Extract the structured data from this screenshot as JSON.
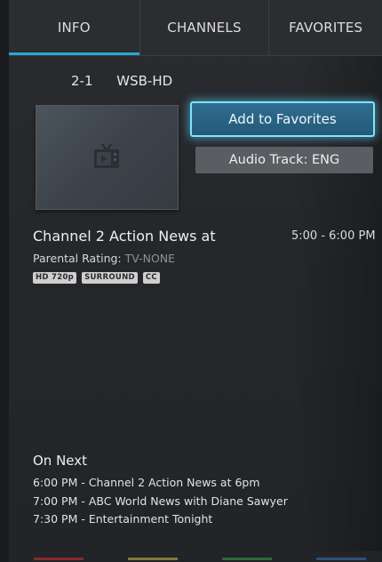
{
  "tabs": [
    {
      "label": "INFO",
      "active": true
    },
    {
      "label": "CHANNELS",
      "active": false
    },
    {
      "label": "FAVORITES",
      "active": false
    }
  ],
  "channel": {
    "number": "2-1",
    "name": "WSB-HD"
  },
  "thumbnail": {
    "icon": "tv-icon"
  },
  "actions": {
    "add_favorites": "Add to Favorites",
    "audio_track": "Audio Track: ENG"
  },
  "program": {
    "title": "Channel 2 Action News at",
    "time": "5:00 - 6:00 PM",
    "rating_label": "Parental Rating:",
    "rating_value": "TV-NONE",
    "badges": [
      "HD 720p",
      "SURROUND",
      "CC"
    ]
  },
  "on_next": {
    "heading": "On Next",
    "items": [
      "6:00 PM - Channel 2 Action News at 6pm",
      "7:00 PM - ABC World News with Diane Sawyer",
      "7:30 PM - Entertainment Tonight"
    ]
  },
  "colors": {
    "accent": "#2aa6d8",
    "focus_glow": "#7fe3ff",
    "hint_red": "#8a2a2a",
    "hint_yellow": "#7d7a3c",
    "hint_green": "#2c6a3a",
    "hint_blue": "#2e4f7a"
  }
}
